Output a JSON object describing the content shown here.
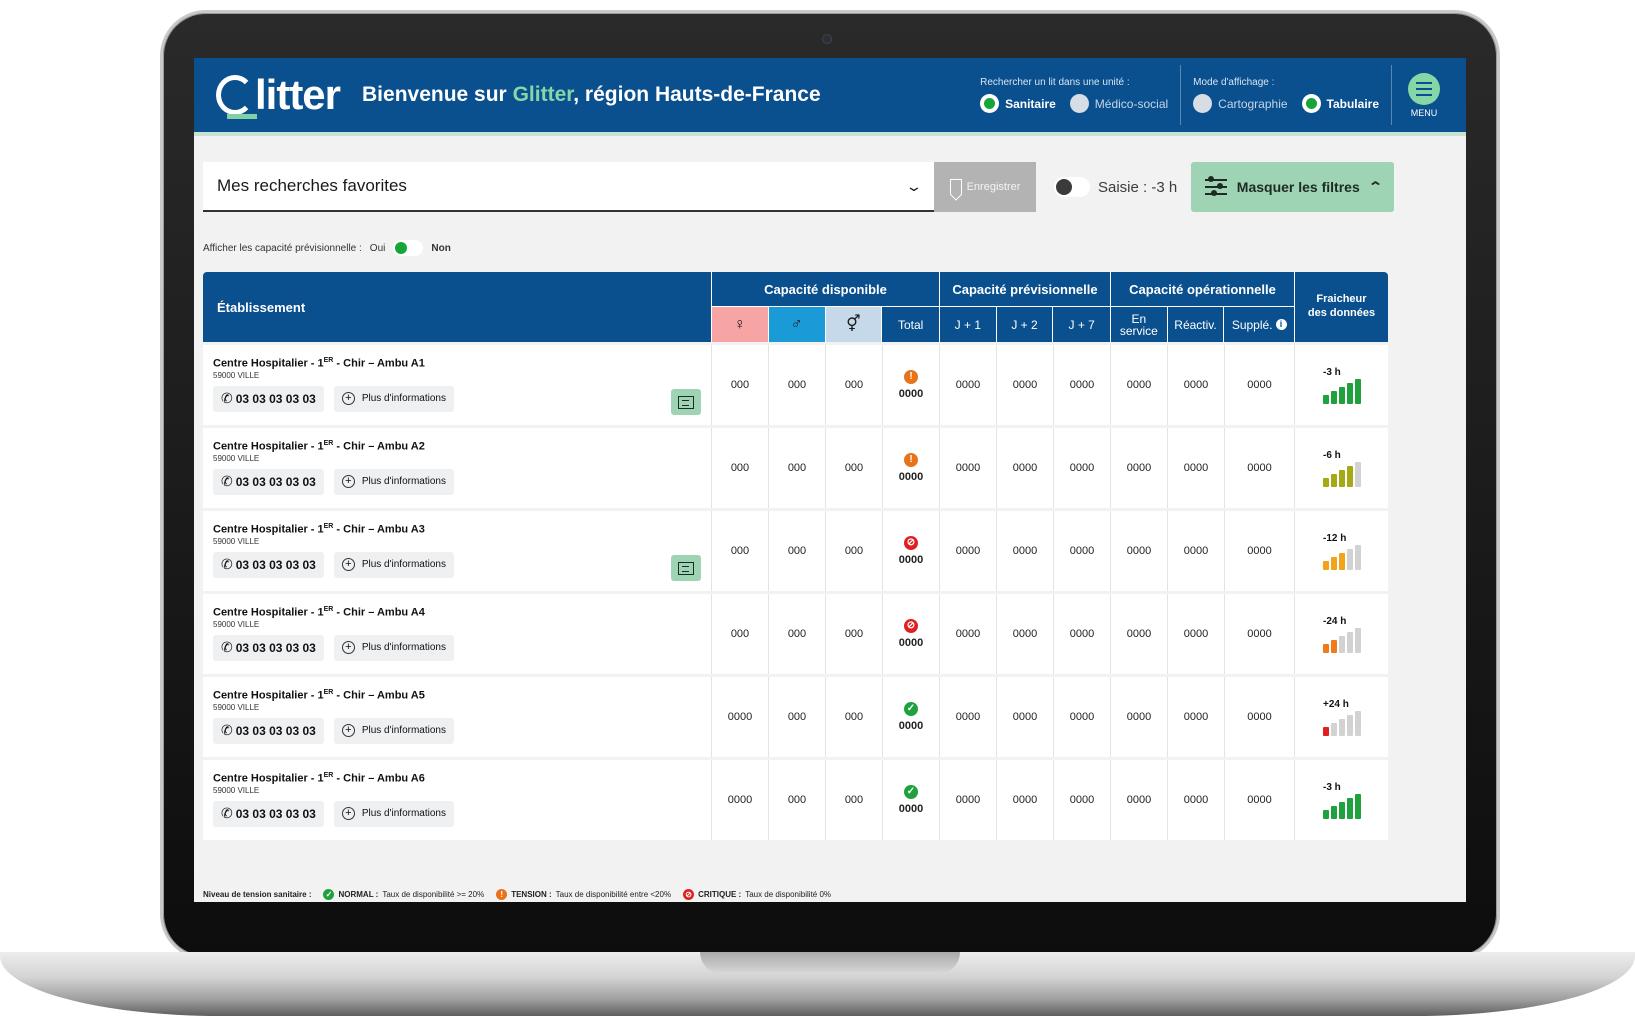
{
  "header": {
    "logo": "litter",
    "welcome_prefix": "Bienvenue sur ",
    "welcome_brand": "Glitter",
    "welcome_suffix": ", région Hauts-de-France",
    "search_unit_label": "Rechercher un lit dans une unité :",
    "search_unit_options": [
      {
        "label": "Sanitaire",
        "selected": true
      },
      {
        "label": "Médico-social",
        "selected": false
      }
    ],
    "display_mode_label": "Mode d'affichage :",
    "display_mode_options": [
      {
        "label": "Cartographie",
        "selected": false
      },
      {
        "label": "Tabulaire",
        "selected": true
      }
    ],
    "menu_label": "MENU"
  },
  "toolbar": {
    "favorites_value": "Mes recherches favorites",
    "save_label": "Enregistrer",
    "saisie_label": "Saisie : -3 h",
    "filters_label": "Masquer les filtres"
  },
  "forecast": {
    "label": "Afficher les capacité prévisionnelle :",
    "yes": "Oui",
    "no": "Non"
  },
  "table": {
    "col_etablissement": "Établissement",
    "group_dispo": "Capacité disponible",
    "group_prev": "Capacité prévisionnelle",
    "group_oper": "Capacité opérationnelle",
    "col_female": "♀",
    "col_male": "♂",
    "col_mixed": "⚥",
    "col_total": "Total",
    "col_j1": "J + 1",
    "col_j2": "J + 2",
    "col_j7": "J + 7",
    "col_en_service_1": "En",
    "col_en_service_2": "service",
    "col_reactiv": "Réactiv.",
    "col_supple": "Supplé.",
    "col_fresh_1": "Fraicheur",
    "col_fresh_2": "des données",
    "phone_label": "03 03 03 03 03",
    "more_info_label": "Plus d'informations",
    "rows": [
      {
        "name_a": "Centre Hospitalier - 1",
        "name_sup": "ER",
        "name_b": " - Chir – Ambu A1",
        "city": "59000 VILLE",
        "comment": true,
        "f": "000",
        "m": "000",
        "x": "000",
        "status": "tension",
        "total": "0000",
        "j1": "0000",
        "j2": "0000",
        "j7": "0000",
        "es": "0000",
        "re": "0000",
        "su": "0000",
        "fresh": "-3 h",
        "fresh_level": 5
      },
      {
        "name_a": "Centre Hospitalier - 1",
        "name_sup": "ER",
        "name_b": " - Chir – Ambu A2",
        "city": "59000 VILLE",
        "comment": false,
        "f": "000",
        "m": "000",
        "x": "000",
        "status": "tension",
        "total": "0000",
        "j1": "0000",
        "j2": "0000",
        "j7": "0000",
        "es": "0000",
        "re": "0000",
        "su": "0000",
        "fresh": "-6 h",
        "fresh_level": 4
      },
      {
        "name_a": "Centre Hospitalier - 1",
        "name_sup": "ER",
        "name_b": " - Chir – Ambu A3",
        "city": "59000 VILLE",
        "comment": true,
        "f": "000",
        "m": "000",
        "x": "000",
        "status": "critique",
        "total": "0000",
        "j1": "0000",
        "j2": "0000",
        "j7": "0000",
        "es": "0000",
        "re": "0000",
        "su": "0000",
        "fresh": "-12 h",
        "fresh_level": 3
      },
      {
        "name_a": "Centre Hospitalier - 1",
        "name_sup": "ER",
        "name_b": " - Chir – Ambu A4",
        "city": "59000 VILLE",
        "comment": false,
        "f": "000",
        "m": "000",
        "x": "000",
        "status": "critique",
        "total": "0000",
        "j1": "0000",
        "j2": "0000",
        "j7": "0000",
        "es": "0000",
        "re": "0000",
        "su": "0000",
        "fresh": "-24 h",
        "fresh_level": 2
      },
      {
        "name_a": "Centre Hospitalier - 1",
        "name_sup": "ER",
        "name_b": " - Chir – Ambu A5",
        "city": "59000 VILLE",
        "comment": false,
        "f": "0000",
        "m": "000",
        "x": "000",
        "status": "normal",
        "total": "0000",
        "j1": "0000",
        "j2": "0000",
        "j7": "0000",
        "es": "0000",
        "re": "0000",
        "su": "0000",
        "fresh": "+24 h",
        "fresh_level": 1
      },
      {
        "name_a": "Centre Hospitalier - 1",
        "name_sup": "ER",
        "name_b": " - Chir – Ambu A6",
        "city": "59000 VILLE",
        "comment": false,
        "f": "0000",
        "m": "000",
        "x": "000",
        "status": "normal",
        "total": "0000",
        "j1": "0000",
        "j2": "0000",
        "j7": "0000",
        "es": "0000",
        "re": "0000",
        "su": "0000",
        "fresh": "-3 h",
        "fresh_level": 5
      }
    ]
  },
  "legend": {
    "title": "Niveau de tension sanitaire :",
    "normal_label": "NORMAL :",
    "normal_text": "Taux de disponibilité >= 20%",
    "tension_label": "TENSION :",
    "tension_text": "Taux de disponibilité entre <20%",
    "critique_label": "CRITIQUE :",
    "critique_text": "Taux de disponibilité 0%"
  },
  "colors": {
    "primary": "#0a4f8e",
    "accent": "#9ed3b3",
    "normal": "#1fa23e",
    "tension": "#e8731a",
    "critique": "#e02020",
    "fresh_5": "#1fa23e",
    "fresh_4": "#a5a914",
    "fresh_3": "#f2a31a",
    "fresh_2": "#f07a1a",
    "fresh_1": "#e02020",
    "fresh_empty": "#d2d2d2"
  }
}
